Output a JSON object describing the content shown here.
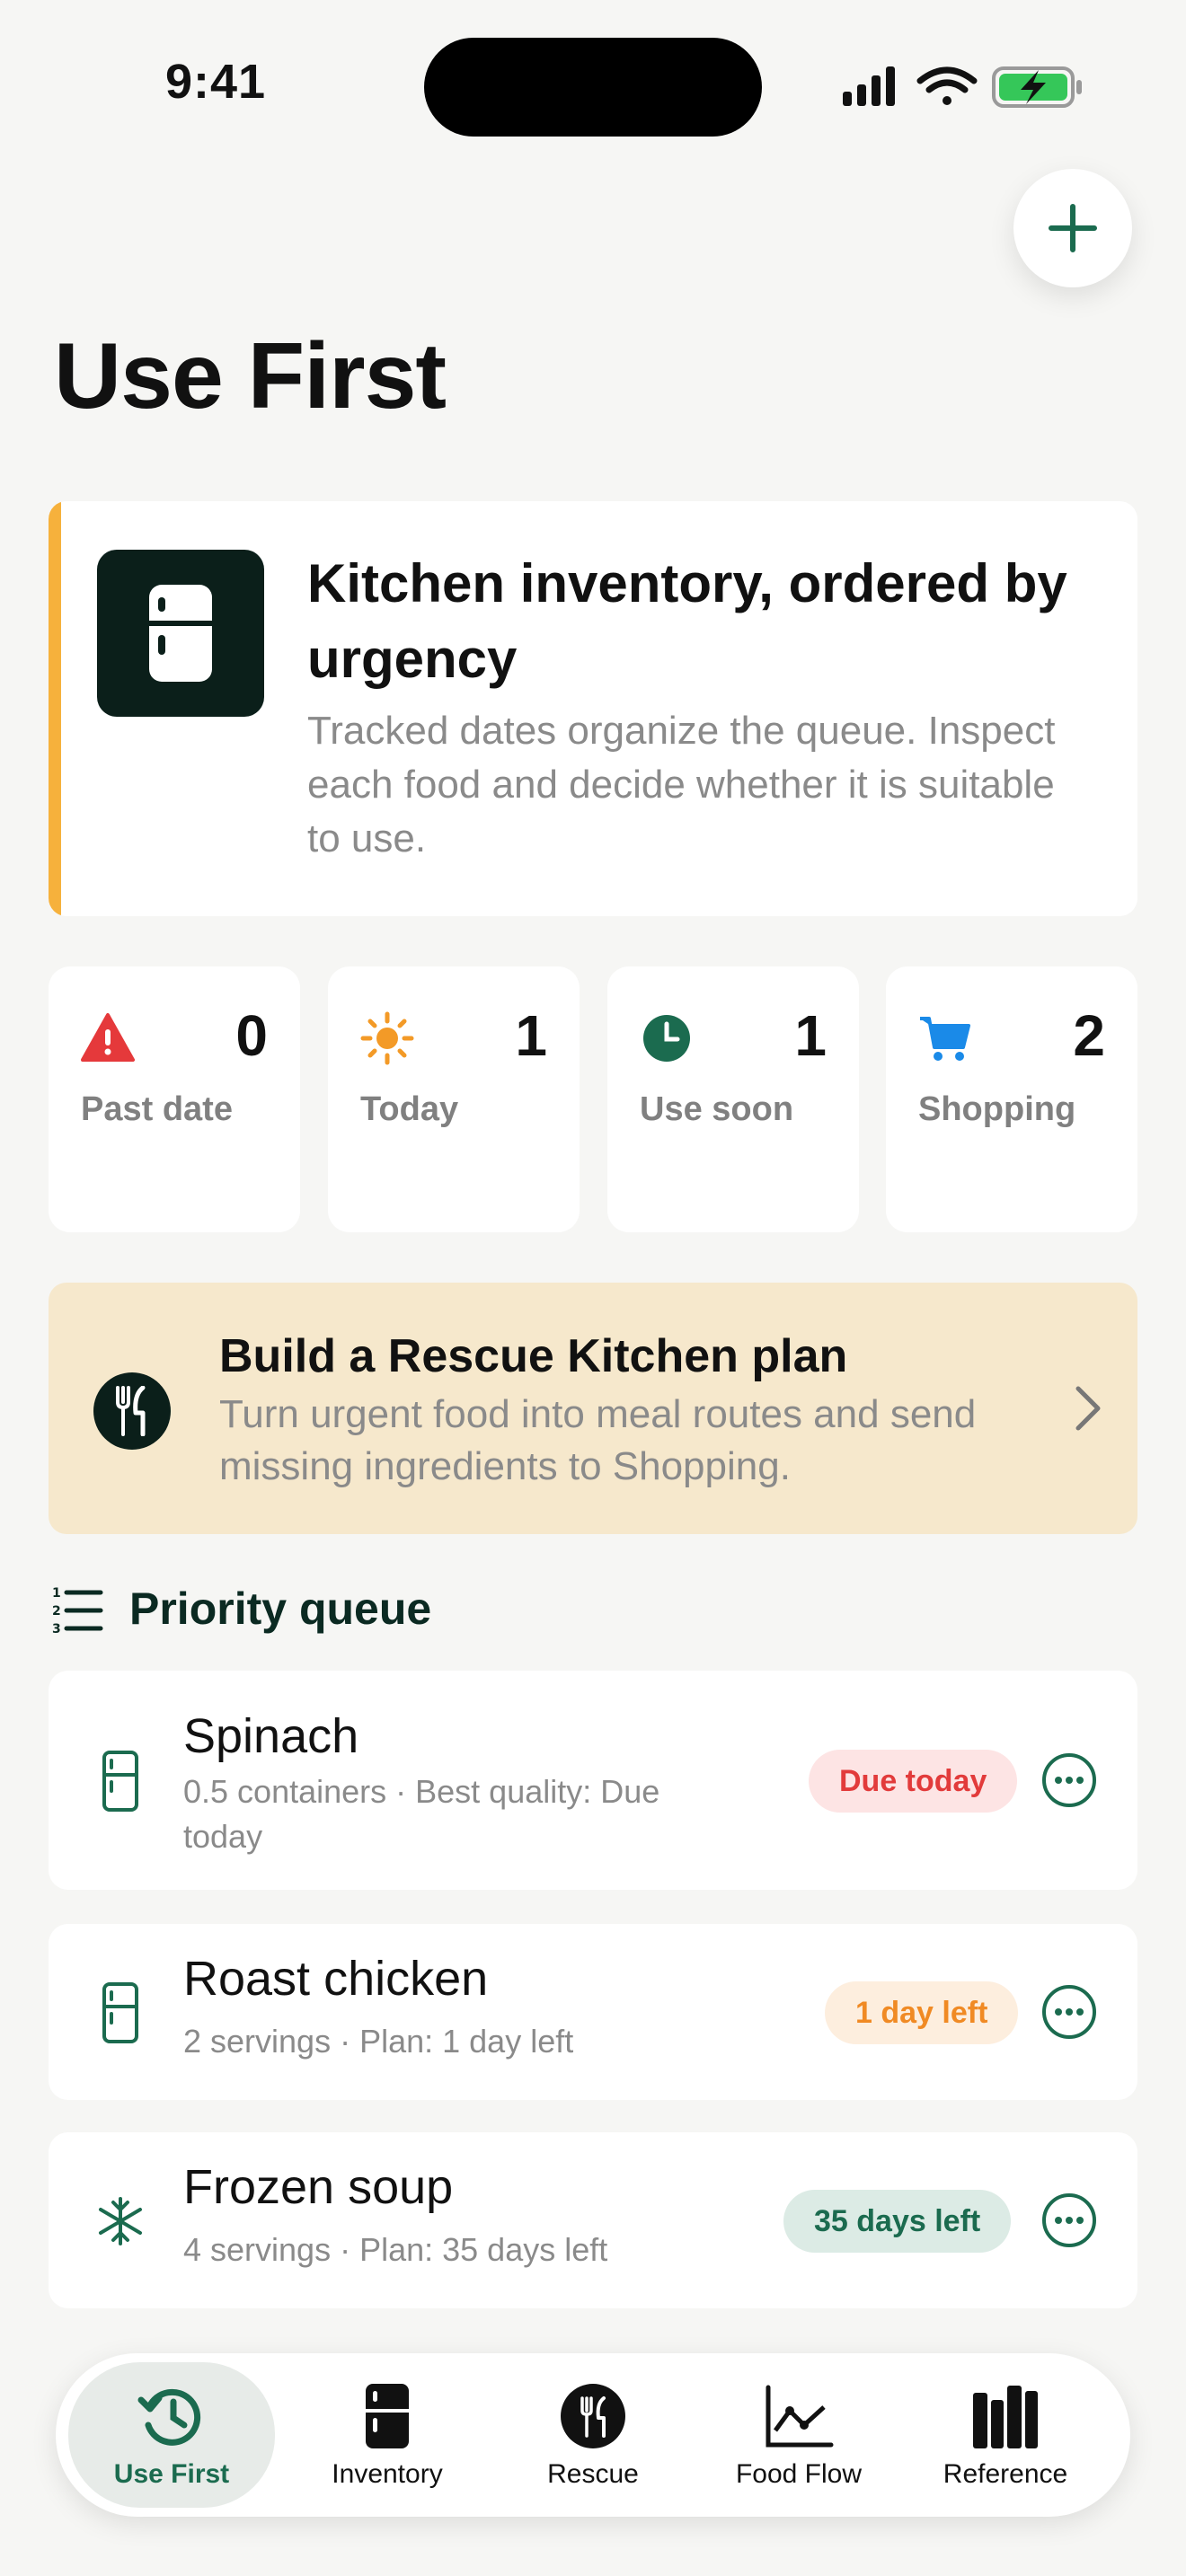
{
  "status_bar": {
    "time": "9:41"
  },
  "page": {
    "title": "Use First"
  },
  "intro": {
    "title": "Kitchen inventory, ordered by urgency",
    "subtitle": "Tracked dates organize the queue. Inspect each food and decide whether it is suitable to use."
  },
  "stats": [
    {
      "label": "Past date",
      "value": "0",
      "icon": "warning-icon",
      "color": "#e5393b"
    },
    {
      "label": "Today",
      "value": "1",
      "icon": "sun-icon",
      "color": "#f39a27"
    },
    {
      "label": "Use soon",
      "value": "1",
      "icon": "clock-icon",
      "color": "#1b6b4f"
    },
    {
      "label": "Shopping",
      "value": "2",
      "icon": "cart-icon",
      "color": "#1a8ae8"
    }
  ],
  "rescue": {
    "title": "Build a Rescue Kitchen plan",
    "subtitle": "Turn urgent food into meal routes and send missing ingredients to Shopping."
  },
  "queue": {
    "title": "Priority queue",
    "items": [
      {
        "name": "Spinach",
        "meta": "0.5 containers · Best quality: Due today",
        "badge": "Due today",
        "icon": "fridge-icon",
        "status": "red"
      },
      {
        "name": "Roast chicken",
        "meta": "2 servings · Plan: 1 day left",
        "badge": "1 day left",
        "icon": "fridge-icon",
        "status": "orange"
      },
      {
        "name": "Frozen soup",
        "meta": "4 servings · Plan: 35 days left",
        "badge": "35 days left",
        "icon": "snowflake-icon",
        "status": "green"
      }
    ]
  },
  "tabs": [
    {
      "label": "Use First",
      "icon": "history-clock-icon",
      "active": true
    },
    {
      "label": "Inventory",
      "icon": "fridge-icon",
      "active": false
    },
    {
      "label": "Rescue",
      "icon": "utensils-icon",
      "active": false
    },
    {
      "label": "Food Flow",
      "icon": "chart-line-icon",
      "active": false
    },
    {
      "label": "Reference",
      "icon": "books-icon",
      "active": false
    }
  ],
  "colors": {
    "accent": "#1b6b4f",
    "dark": "#0b1f1a",
    "intro_bar": "#f6b13c",
    "rescue_bg": "#f6e8cc"
  }
}
